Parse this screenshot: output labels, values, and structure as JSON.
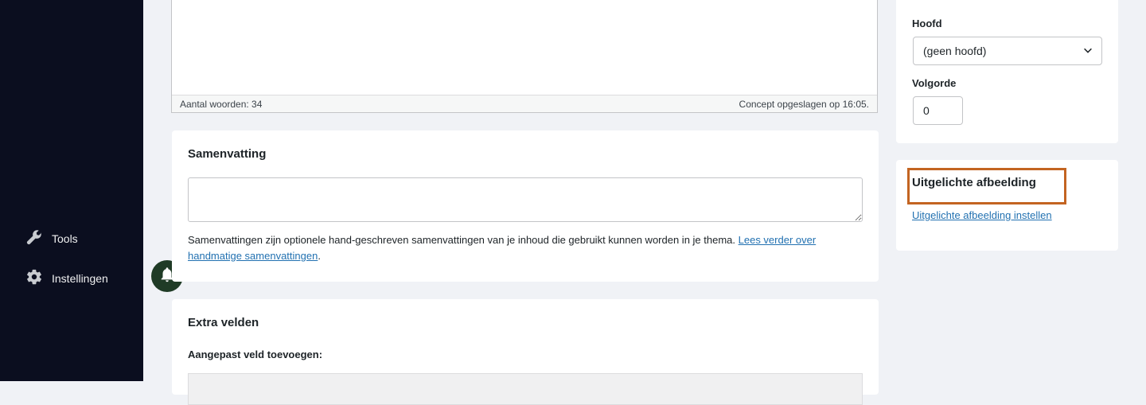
{
  "sidebar": {
    "items": [
      {
        "label": "Tools",
        "icon": "wrench-icon"
      },
      {
        "label": "Instellingen",
        "icon": "gear-icon"
      }
    ]
  },
  "notification": {
    "icon": "bell-icon",
    "color": "#1f3b26"
  },
  "editor": {
    "word_count": "Aantal woorden: 34",
    "save_status": "Concept opgeslagen op 16:05."
  },
  "excerpt": {
    "title": "Samenvatting",
    "value": "",
    "help_text": "Samenvattingen zijn optionele hand-geschreven samenvattingen van je inhoud die gebruikt kunnen worden in je thema. ",
    "link_text": "Lees verder over handmatige samenvattingen",
    "help_end": "."
  },
  "extra_fields": {
    "title": "Extra velden",
    "add_label": "Aangepast veld toevoegen:"
  },
  "page_attributes": {
    "parent_label": "Hoofd",
    "parent_value": "(geen hoofd)",
    "order_label": "Volgorde",
    "order_value": "0"
  },
  "featured_image": {
    "title": "Uitgelichte afbeelding",
    "set_link": "Uitgelichte afbeelding instellen",
    "highlight_color": "#c36421"
  },
  "colors": {
    "sidebar_bg": "#0b0e1f",
    "page_bg": "#f0f2f6",
    "link": "#2271b1"
  }
}
